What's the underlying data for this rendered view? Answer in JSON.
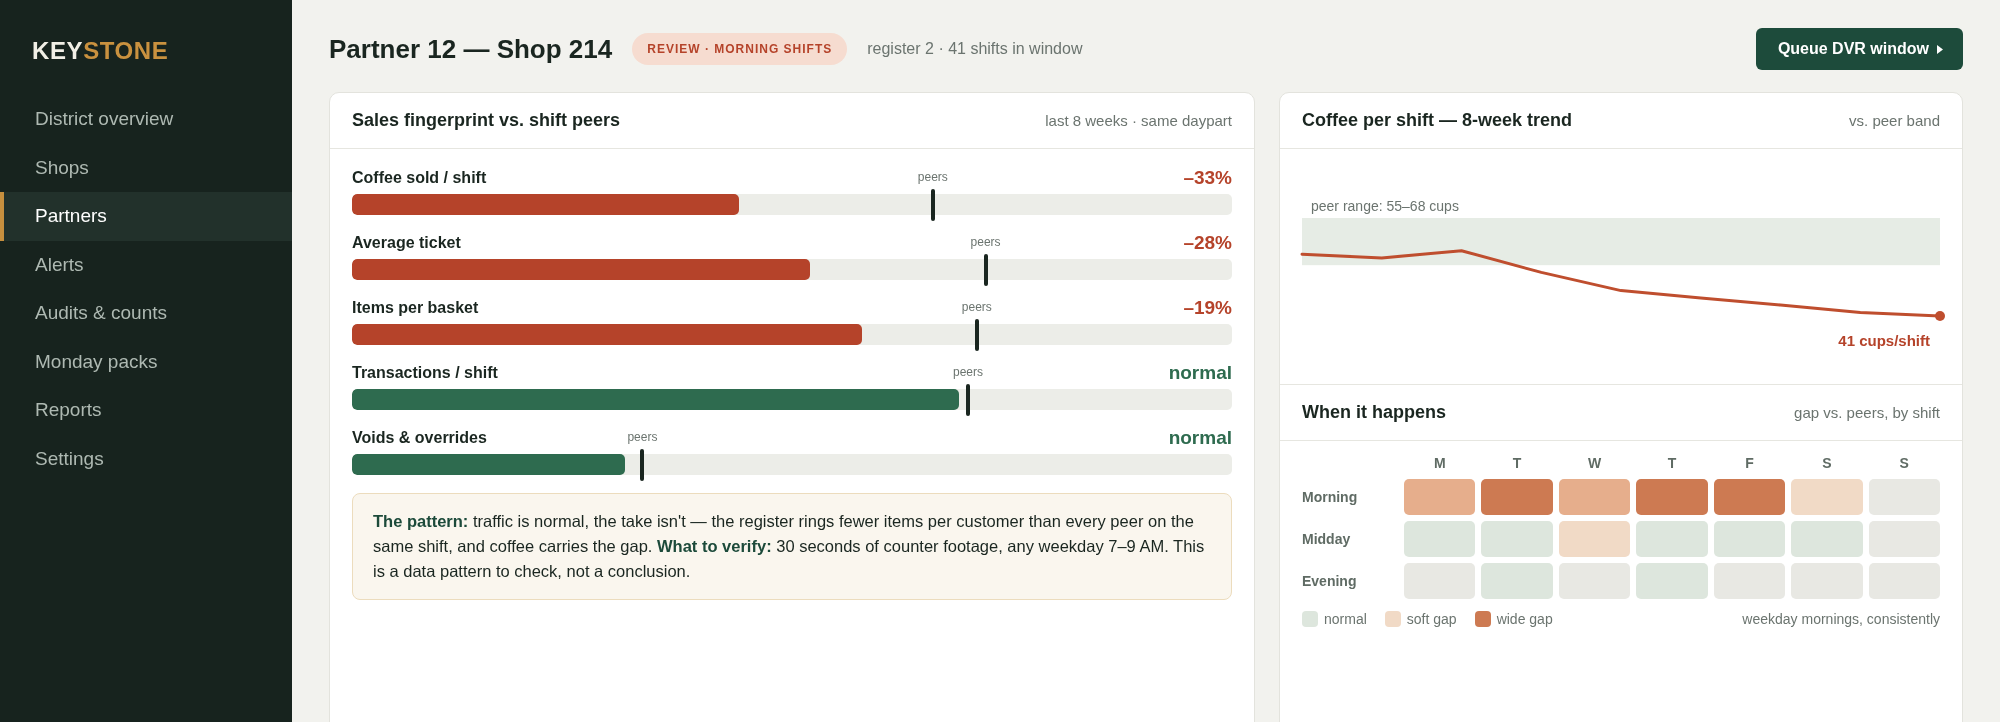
{
  "sidebar": {
    "logo": {
      "lead": "KEY",
      "accent": "STONE"
    },
    "items": [
      {
        "label": "District overview",
        "selected": false
      },
      {
        "label": "Shops",
        "selected": false
      },
      {
        "label": "Partners",
        "selected": true
      },
      {
        "label": "Alerts",
        "selected": false
      },
      {
        "label": "Audits & counts",
        "selected": false
      },
      {
        "label": "Monday packs",
        "selected": false
      },
      {
        "label": "Reports",
        "selected": false
      },
      {
        "label": "Settings",
        "selected": false
      }
    ]
  },
  "header": {
    "title": "Partner 12 — Shop 214",
    "badge": "REVIEW · MORNING SHIFTS",
    "subtitle": "register 2 · 41 shifts in window",
    "action": "Queue DVR window"
  },
  "fingerprint": {
    "title": "Sales fingerprint vs. shift peers",
    "note": "last 8 weeks · same daypart",
    "metrics": [
      {
        "label": "Coffee sold / shift",
        "level": 0.44,
        "peer": {
          "label": "peers",
          "level": 0.66
        },
        "delta": "–33%",
        "kind": "gap"
      },
      {
        "label": "Average ticket",
        "level": 0.52,
        "peer": {
          "label": "peers",
          "level": 0.72
        },
        "delta": "–28%",
        "kind": "gap"
      },
      {
        "label": "Items per basket",
        "level": 0.58,
        "peer": {
          "label": "peers",
          "level": 0.71
        },
        "delta": "–19%",
        "kind": "gap"
      },
      {
        "label": "Transactions / shift",
        "level": 0.69,
        "peer": {
          "label": "peers",
          "level": 0.7
        },
        "delta": "normal",
        "kind": "normal"
      },
      {
        "label": "Voids & overrides",
        "level": 0.31,
        "peer": {
          "label": "peers",
          "level": 0.33
        },
        "delta": "normal",
        "kind": "normal"
      }
    ],
    "callout": "**The pattern:** traffic is normal, the take isn't — the register rings fewer items per customer than every peer on the same shift, and coffee carries the gap. **What to verify:** 30 seconds of counter footage, any weekday 7–9 AM. This is a data pattern to check, not a conclusion."
  },
  "trend": {
    "title": "Coffee per shift — 8-week trend",
    "note": "vs. peer band",
    "band_label": "peer range: 55–68 cups",
    "end_label": "41 cups/shift"
  },
  "heatmap": {
    "title": "When it happens",
    "note": "gap vs. peers, by shift",
    "days": [
      "M",
      "T",
      "W",
      "T",
      "F",
      "S",
      "S"
    ],
    "rows": [
      {
        "label": "Morning",
        "cells": [
          {
            "color": "#e6ae8c"
          },
          {
            "color": "#cd7a52"
          },
          {
            "color": "#e6ae8c"
          },
          {
            "color": "#cd7a52"
          },
          {
            "color": "#cd7a52"
          },
          {
            "color": "#f1dac6"
          },
          {
            "color": "#e8e8e3"
          }
        ]
      },
      {
        "label": "Midday",
        "cells": [
          {
            "color": "#dde6dd"
          },
          {
            "color": "#dde6dd"
          },
          {
            "color": "#f1dac6"
          },
          {
            "color": "#dde6dd"
          },
          {
            "color": "#dde6dd"
          },
          {
            "color": "#dde6dd"
          },
          {
            "color": "#e8e8e3"
          }
        ]
      },
      {
        "label": "Evening",
        "cells": [
          {
            "color": "#e8e8e3"
          },
          {
            "color": "#dde6dd"
          },
          {
            "color": "#e8e8e3"
          },
          {
            "color": "#dde6dd"
          },
          {
            "color": "#e8e8e3"
          },
          {
            "color": "#e8e8e3"
          },
          {
            "color": "#e8e8e3"
          }
        ]
      }
    ],
    "legend": [
      {
        "label": "normal",
        "color": "#dde6dd"
      },
      {
        "label": "soft gap",
        "color": "#f1dac6"
      },
      {
        "label": "wide gap",
        "color": "#cd7a52"
      }
    ],
    "summary": "weekday mornings, consistently"
  }
}
